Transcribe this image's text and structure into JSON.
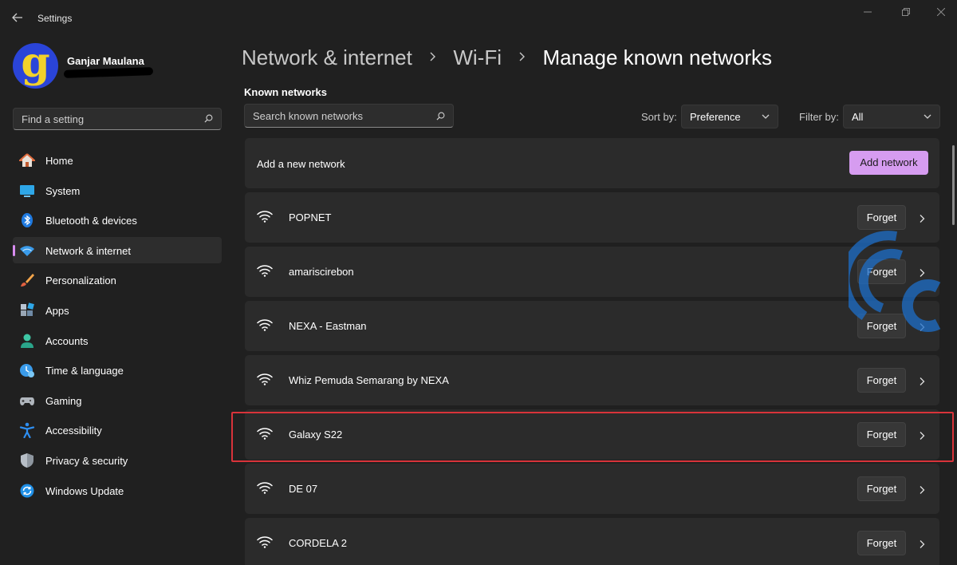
{
  "window": {
    "title": "Settings"
  },
  "user": {
    "avatar_letter": "g",
    "name": "Ganjar Maulana"
  },
  "sidebar": {
    "search_placeholder": "Find a setting",
    "items": [
      {
        "label": "Home",
        "icon": "home-icon",
        "active": false
      },
      {
        "label": "System",
        "icon": "system-icon",
        "active": false
      },
      {
        "label": "Bluetooth & devices",
        "icon": "bluetooth-icon",
        "active": false
      },
      {
        "label": "Network & internet",
        "icon": "network-icon",
        "active": true
      },
      {
        "label": "Personalization",
        "icon": "brush-icon",
        "active": false
      },
      {
        "label": "Apps",
        "icon": "apps-icon",
        "active": false
      },
      {
        "label": "Accounts",
        "icon": "accounts-icon",
        "active": false
      },
      {
        "label": "Time & language",
        "icon": "time-language-icon",
        "active": false
      },
      {
        "label": "Gaming",
        "icon": "gaming-icon",
        "active": false
      },
      {
        "label": "Accessibility",
        "icon": "accessibility-icon",
        "active": false
      },
      {
        "label": "Privacy & security",
        "icon": "shield-icon",
        "active": false
      },
      {
        "label": "Windows Update",
        "icon": "update-icon",
        "active": false
      }
    ]
  },
  "breadcrumb": {
    "items": [
      "Network & internet",
      "Wi-Fi",
      "Manage known networks"
    ]
  },
  "main": {
    "section_title": "Known networks",
    "search_placeholder": "Search known networks",
    "sort_label": "Sort by:",
    "sort_value": "Preference",
    "filter_label": "Filter by:",
    "filter_value": "All",
    "add_network_label": "Add a new network",
    "add_network_button": "Add network",
    "forget_label": "Forget",
    "networks": [
      {
        "name": "POPNET"
      },
      {
        "name": "amariscirebon"
      },
      {
        "name": "NEXA - Eastman"
      },
      {
        "name": "Whiz Pemuda Semarang by NEXA"
      },
      {
        "name": "Galaxy S22",
        "highlighted": true
      },
      {
        "name": "DE 07"
      },
      {
        "name": "CORDELA 2"
      }
    ]
  },
  "colors": {
    "accent": "#d69cf0",
    "highlight_border": "#d8333a",
    "background": "#202020",
    "card": "#2b2b2b"
  }
}
